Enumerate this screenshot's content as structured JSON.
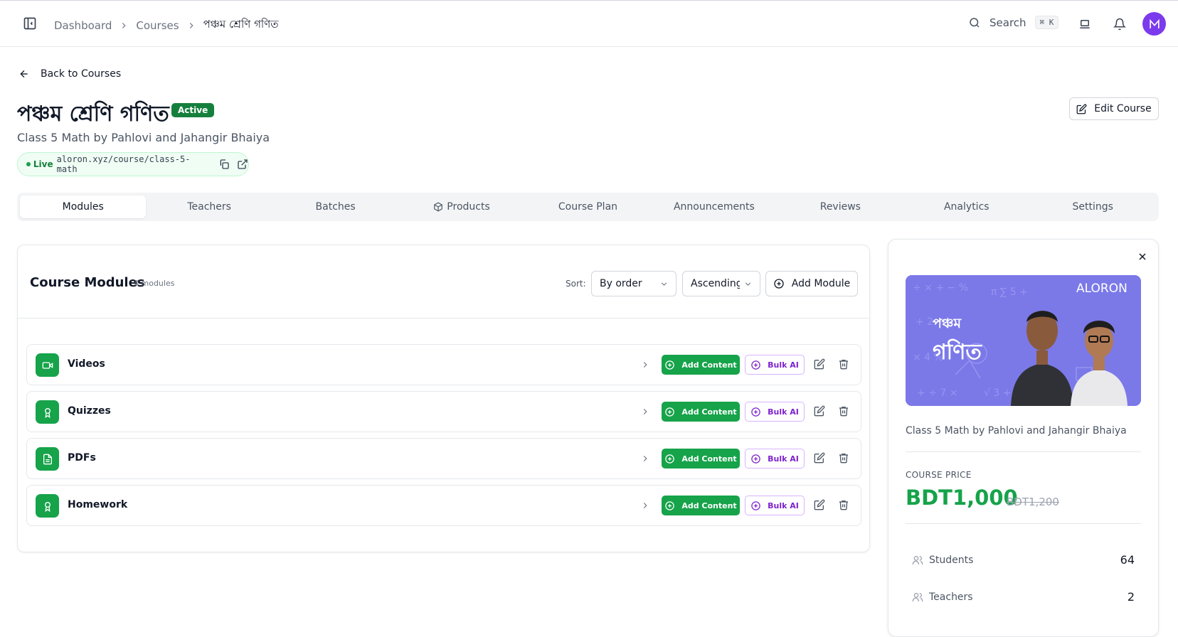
{
  "breadcrumb": {
    "items": [
      "Dashboard",
      "Courses"
    ],
    "current": "পঞ্চম শ্রেণি গণিত"
  },
  "search": {
    "label": "Search",
    "shortcut": "⌘ K"
  },
  "avatar": {
    "initial": "M",
    "color": "#7c3aed"
  },
  "header": {
    "back_label": "Back to Courses",
    "title": "পঞ্চম শ্রেণি গণিত",
    "status": "Active",
    "subtitle": "Class 5 Math by Pahlovi and Jahangir Bhaiya",
    "live_label": "Live",
    "live_url": "aloron.xyz/course/class-5-math",
    "edit_label": "Edit Course"
  },
  "tabs": [
    {
      "label": "Modules",
      "active": true
    },
    {
      "label": "Teachers"
    },
    {
      "label": "Batches"
    },
    {
      "label": "Products",
      "icon": "package-icon"
    },
    {
      "label": "Course Plan"
    },
    {
      "label": "Announcements"
    },
    {
      "label": "Reviews"
    },
    {
      "label": "Analytics"
    },
    {
      "label": "Settings"
    }
  ],
  "modules": {
    "title": "Course Modules",
    "count": "4 modules",
    "sort_label": "Sort:",
    "sort_by": "By order",
    "sort_dir": "Ascending",
    "add_label": "Add Module",
    "add_content_label": "Add Content",
    "bulk_label": "Bulk AI",
    "items": [
      {
        "name": "Videos",
        "icon": "video-icon"
      },
      {
        "name": "Quizzes",
        "icon": "award-icon"
      },
      {
        "name": "PDFs",
        "icon": "file-text-icon"
      },
      {
        "name": "Homework",
        "icon": "award-icon"
      }
    ]
  },
  "panel": {
    "thumb": {
      "brand": "ALORON",
      "line1": "পঞ্চম",
      "line2": "গণিত"
    },
    "description": "Class 5 Math by Pahlovi and Jahangir Bhaiya",
    "price_label": "COURSE PRICE",
    "price": "BDT1,000",
    "price_old": "BDT1,200",
    "stats": [
      {
        "label": "Students",
        "value": "64"
      },
      {
        "label": "Teachers",
        "value": "2"
      }
    ]
  },
  "colors": {
    "primary_green": "#16a34a",
    "badge_green": "#15803d",
    "purple": "#7e22ce",
    "thumb_bg": "#7b79e8"
  }
}
